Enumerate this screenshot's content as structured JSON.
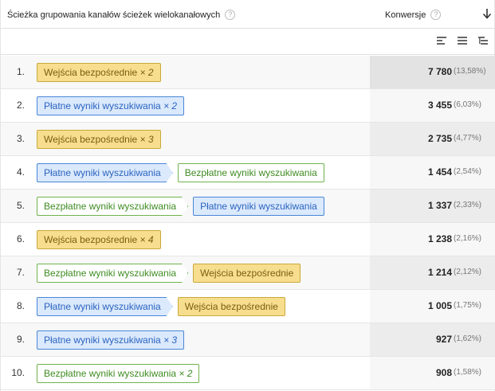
{
  "header": {
    "path_label": "Ścieżka grupowania kanałów ścieżek wielokanałowych",
    "conv_label": "Konwersje",
    "help_glyph": "?"
  },
  "toolbar": {
    "icons": [
      "bar-view-icon",
      "list-view-icon",
      "tree-view-icon"
    ]
  },
  "colors": {
    "direct": "#f7dd8e",
    "paid": "#dbe9fc",
    "organic": "#ffffff"
  },
  "rows": [
    {
      "num": "1.",
      "chips": [
        {
          "type": "direct",
          "label": "Wejścia bezpośrednie",
          "mult": "× 2"
        }
      ],
      "conv": "7 780",
      "pct": "(13,58%)"
    },
    {
      "num": "2.",
      "chips": [
        {
          "type": "paid",
          "label": "Płatne wyniki wyszukiwania",
          "mult": "× 2"
        }
      ],
      "conv": "3 455",
      "pct": "(6,03%)"
    },
    {
      "num": "3.",
      "chips": [
        {
          "type": "direct",
          "label": "Wejścia bezpośrednie",
          "mult": "× 3"
        }
      ],
      "conv": "2 735",
      "pct": "(4,77%)"
    },
    {
      "num": "4.",
      "chips": [
        {
          "type": "paid",
          "label": "Płatne wyniki wyszukiwania",
          "mult": ""
        },
        {
          "type": "organic",
          "label": "Bezpłatne wyniki wyszukiwania",
          "mult": ""
        }
      ],
      "conv": "1 454",
      "pct": "(2,54%)"
    },
    {
      "num": "5.",
      "chips": [
        {
          "type": "organic",
          "label": "Bezpłatne wyniki wyszukiwania",
          "mult": ""
        },
        {
          "type": "paid",
          "label": "Płatne wyniki wyszukiwania",
          "mult": ""
        }
      ],
      "conv": "1 337",
      "pct": "(2,33%)"
    },
    {
      "num": "6.",
      "chips": [
        {
          "type": "direct",
          "label": "Wejścia bezpośrednie",
          "mult": "× 4"
        }
      ],
      "conv": "1 238",
      "pct": "(2,16%)"
    },
    {
      "num": "7.",
      "chips": [
        {
          "type": "organic",
          "label": "Bezpłatne wyniki wyszukiwania",
          "mult": ""
        },
        {
          "type": "direct",
          "label": "Wejścia bezpośrednie",
          "mult": ""
        }
      ],
      "conv": "1 214",
      "pct": "(2,12%)"
    },
    {
      "num": "8.",
      "chips": [
        {
          "type": "paid",
          "label": "Płatne wyniki wyszukiwania",
          "mult": ""
        },
        {
          "type": "direct",
          "label": "Wejścia bezpośrednie",
          "mult": ""
        }
      ],
      "conv": "1 005",
      "pct": "(1,75%)"
    },
    {
      "num": "9.",
      "chips": [
        {
          "type": "paid",
          "label": "Płatne wyniki wyszukiwania",
          "mult": "× 3"
        }
      ],
      "conv": "927",
      "pct": "(1,62%)"
    },
    {
      "num": "10.",
      "chips": [
        {
          "type": "organic",
          "label": "Bezpłatne wyniki wyszukiwania",
          "mult": "× 2"
        }
      ],
      "conv": "908",
      "pct": "(1,58%)"
    }
  ]
}
